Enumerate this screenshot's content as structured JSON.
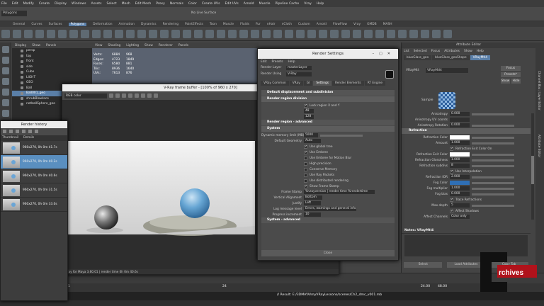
{
  "menubar": {
    "items": [
      "File",
      "Edit",
      "Modify",
      "Create",
      "Display",
      "Windows",
      "Assets",
      "Select",
      "Mesh",
      "Edit Mesh",
      "Proxy",
      "Normals",
      "Color",
      "Create UVs",
      "Edit UVs",
      "Arnold",
      "Muscle",
      "Pipeline Cache",
      "Vray",
      "Help"
    ]
  },
  "status": {
    "mode": "Polygons",
    "live": "No Live Surface"
  },
  "shelf": {
    "tabs": [
      "General",
      "Curves",
      "Surfaces",
      "Polygons",
      "Deformation",
      "Animation",
      "Dynamics",
      "Rendering",
      "PaintEffects",
      "Toon",
      "Muscle",
      "Fluids",
      "Fur",
      "nHair",
      "nCloth",
      "Custom",
      "Arnold",
      "FlowFlow",
      "Vray",
      "GMDB",
      "MASH"
    ],
    "active_tab": "Polygons"
  },
  "outliner": {
    "menu": [
      "Display",
      "Show",
      "Panels"
    ],
    "items": [
      {
        "label": "persp",
        "selected": false
      },
      {
        "label": "top",
        "selected": false
      },
      {
        "label": "front",
        "selected": false
      },
      {
        "label": "side",
        "selected": false
      },
      {
        "label": "Cube",
        "selected": false
      },
      {
        "label": "LIGHT",
        "selected": false
      },
      {
        "label": "GEO",
        "selected": false
      },
      {
        "label": "Ball",
        "selected": false
      },
      {
        "label": "Ball001_geo",
        "selected": true
      },
      {
        "label": "shrubBlowlace",
        "selected": false
      },
      {
        "label": "netballSphere_geo",
        "selected": false
      }
    ]
  },
  "viewport": {
    "menu": [
      "View",
      "Shading",
      "Lighting",
      "Show",
      "Renderer",
      "Panels"
    ],
    "hud": [
      {
        "label": "Verts:",
        "a": "6884",
        "b": "968"
      },
      {
        "label": "Edges:",
        "a": "4723",
        "b": "1849"
      },
      {
        "label": "Faces:",
        "a": "6580",
        "b": "881"
      },
      {
        "label": "Tris:",
        "a": "8936",
        "b": "1640"
      },
      {
        "label": "UVs:",
        "a": "7613",
        "b": "876"
      }
    ]
  },
  "vfb": {
    "title": "V-Ray frame buffer - [100% of 960 x 270]",
    "channel": "RGB color",
    "status": "Vray for Maya 3.60.01 | render time 0h 0m 40.6s"
  },
  "history": {
    "title": "Render history",
    "col_thumb": "Thumbnail",
    "col_details": "Details",
    "items": [
      {
        "detail": "960x270, 0h 0m 41.7s",
        "selected": false
      },
      {
        "detail": "960x270, 0h 0m 40.2s",
        "selected": true
      },
      {
        "detail": "960x270, 0h 0m 40.6s",
        "selected": false
      },
      {
        "detail": "960x270, 0h 0m 31.5s",
        "selected": false
      },
      {
        "detail": "960x270, 0h 0m 33.0s",
        "selected": false
      }
    ]
  },
  "render_settings": {
    "title": "Render Settings",
    "menu": [
      "Edit",
      "Presets",
      "Help"
    ],
    "layer_label": "Render Layer",
    "layer_value": "masterLayer",
    "using_label": "Render Using",
    "using_value": "V-Ray",
    "tabs": [
      "VRay Common",
      "VRay",
      "GI",
      "Settings",
      "Render Elements",
      "RT Engine"
    ],
    "active_tab": "Settings",
    "sections": {
      "default_disp": "Default displacement and subdivision",
      "region": "Render region division",
      "lock_label": "Lock region X and Y",
      "region_x": "48",
      "region_y": "128",
      "region_adv": "Render region - advanced",
      "system": "System",
      "dynamic_mem_label": "Dynamic memory limit (MB)",
      "dynamic_mem_value": "5000",
      "default_geo_label": "Default Geometry",
      "default_geo_value": "Auto",
      "checks": [
        {
          "label": "Use global tree",
          "on": true
        },
        {
          "label": "Use Embree",
          "on": true
        },
        {
          "label": "Use Embree for Motion Blur",
          "on": false
        },
        {
          "label": "High precision",
          "on": false
        },
        {
          "label": "Conserve Memory",
          "on": false
        },
        {
          "label": "Use Ray Packets",
          "on": false
        },
        {
          "label": "Use distributed rendering",
          "on": false
        },
        {
          "label": "Show Frame Stamp",
          "on": true
        }
      ],
      "frame_stamp_label": "Frame Stamp",
      "frame_stamp_value": "%vrayversion | render time %rendertime",
      "valign_label": "Vertical Alignment",
      "valign_value": "Bottom",
      "justify_label": "Justify",
      "justify_value": "Left",
      "log_label": "Log message level",
      "log_value": "Errors, warnings and general info",
      "progress_label": "Progress increment",
      "progress_value": "10",
      "sys_adv": "System - advanced"
    },
    "close": "Close"
  },
  "attribute_editor": {
    "header": "Attribute Editor",
    "menu": [
      "List",
      "Selected",
      "Focus",
      "Attributes",
      "Show",
      "Help"
    ],
    "node_tabs": [
      "blueGlass_geo",
      "blueGlass_geoShape",
      "VRayMtl4"
    ],
    "active_tab": "VRayMtl4",
    "type_label": "VRayMtl:",
    "type_value": "VRayMtl4",
    "focus_btn": "Focus",
    "presets_btn": "Presets*",
    "show_btn": "Show",
    "hide_btn": "Hide",
    "sample_label": "Sample",
    "rows_top": [
      {
        "label": "Anisotropy",
        "value": "0.000"
      },
      {
        "label": "Anisotropy UV coords",
        "value": ""
      },
      {
        "label": "Anisotropy Rotation",
        "value": "0.000"
      }
    ],
    "refraction_section": "Refraction",
    "refraction_rows": [
      {
        "label": "Refraction Color",
        "value": "",
        "kind": "color"
      },
      {
        "label": "Amount",
        "value": "1.000"
      },
      {
        "label": "",
        "value": "Refraction Exit Color On",
        "kind": "check"
      },
      {
        "label": "Refraction Exit Color",
        "value": "",
        "kind": "color"
      },
      {
        "label": "Refraction Glossiness",
        "value": "1.000"
      },
      {
        "label": "Refraction subdivs",
        "value": "8"
      },
      {
        "label": "",
        "value": "Use Interpolation",
        "kind": "check"
      },
      {
        "label": "Refraction IOR",
        "value": "2.000"
      },
      {
        "label": "Fog Color",
        "value": "",
        "kind": "color"
      },
      {
        "label": "Fog multiplier",
        "value": "1.000"
      },
      {
        "label": "Fog bias",
        "value": "0.000"
      },
      {
        "label": "",
        "value": "Trace Refractions",
        "kind": "check"
      },
      {
        "label": "Max depth",
        "value": "5"
      },
      {
        "label": "",
        "value": "Affect Shadows",
        "kind": "check"
      },
      {
        "label": "Affect Channels",
        "value": "Color only"
      }
    ],
    "notes_label": "Notes: VRayMtl4",
    "select_btn": "Select",
    "load_btn": "Load Attributes",
    "copy_btn": "Copy Tab",
    "side_tabs": [
      "Channel Box / Layer Editor",
      "Attribute Editor"
    ]
  },
  "timeline": {
    "range_start": "1",
    "range_mid": "24",
    "range_end": "24.00",
    "range_max": "48.00"
  },
  "cmdline": {
    "result": "// Result: E:/3DMAYA/myVRayLessons/scenes/Ch2_dmc_v001.mb"
  },
  "watermark": {
    "text": "rchives"
  },
  "colors": {
    "accent": "#5a7fa8",
    "panel": "#444444",
    "title": "#ececec"
  }
}
